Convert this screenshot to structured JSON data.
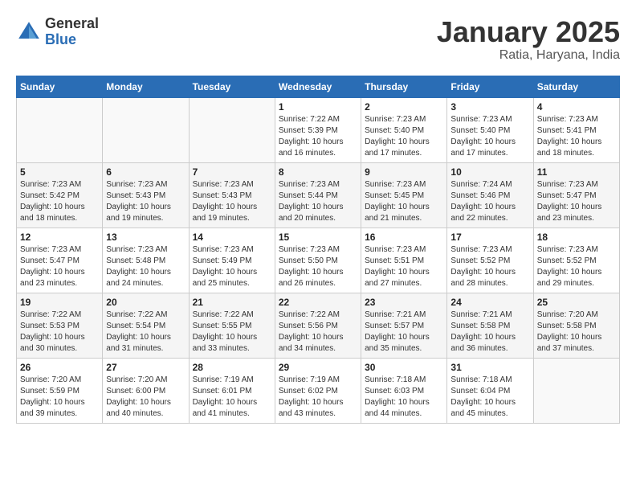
{
  "header": {
    "logo_general": "General",
    "logo_blue": "Blue",
    "month_title": "January 2025",
    "location": "Ratia, Haryana, India"
  },
  "days_of_week": [
    "Sunday",
    "Monday",
    "Tuesday",
    "Wednesday",
    "Thursday",
    "Friday",
    "Saturday"
  ],
  "weeks": [
    [
      {
        "day": "",
        "info": ""
      },
      {
        "day": "",
        "info": ""
      },
      {
        "day": "",
        "info": ""
      },
      {
        "day": "1",
        "info": "Sunrise: 7:22 AM\nSunset: 5:39 PM\nDaylight: 10 hours\nand 16 minutes."
      },
      {
        "day": "2",
        "info": "Sunrise: 7:23 AM\nSunset: 5:40 PM\nDaylight: 10 hours\nand 17 minutes."
      },
      {
        "day": "3",
        "info": "Sunrise: 7:23 AM\nSunset: 5:40 PM\nDaylight: 10 hours\nand 17 minutes."
      },
      {
        "day": "4",
        "info": "Sunrise: 7:23 AM\nSunset: 5:41 PM\nDaylight: 10 hours\nand 18 minutes."
      }
    ],
    [
      {
        "day": "5",
        "info": "Sunrise: 7:23 AM\nSunset: 5:42 PM\nDaylight: 10 hours\nand 18 minutes."
      },
      {
        "day": "6",
        "info": "Sunrise: 7:23 AM\nSunset: 5:43 PM\nDaylight: 10 hours\nand 19 minutes."
      },
      {
        "day": "7",
        "info": "Sunrise: 7:23 AM\nSunset: 5:43 PM\nDaylight: 10 hours\nand 19 minutes."
      },
      {
        "day": "8",
        "info": "Sunrise: 7:23 AM\nSunset: 5:44 PM\nDaylight: 10 hours\nand 20 minutes."
      },
      {
        "day": "9",
        "info": "Sunrise: 7:23 AM\nSunset: 5:45 PM\nDaylight: 10 hours\nand 21 minutes."
      },
      {
        "day": "10",
        "info": "Sunrise: 7:24 AM\nSunset: 5:46 PM\nDaylight: 10 hours\nand 22 minutes."
      },
      {
        "day": "11",
        "info": "Sunrise: 7:23 AM\nSunset: 5:47 PM\nDaylight: 10 hours\nand 23 minutes."
      }
    ],
    [
      {
        "day": "12",
        "info": "Sunrise: 7:23 AM\nSunset: 5:47 PM\nDaylight: 10 hours\nand 23 minutes."
      },
      {
        "day": "13",
        "info": "Sunrise: 7:23 AM\nSunset: 5:48 PM\nDaylight: 10 hours\nand 24 minutes."
      },
      {
        "day": "14",
        "info": "Sunrise: 7:23 AM\nSunset: 5:49 PM\nDaylight: 10 hours\nand 25 minutes."
      },
      {
        "day": "15",
        "info": "Sunrise: 7:23 AM\nSunset: 5:50 PM\nDaylight: 10 hours\nand 26 minutes."
      },
      {
        "day": "16",
        "info": "Sunrise: 7:23 AM\nSunset: 5:51 PM\nDaylight: 10 hours\nand 27 minutes."
      },
      {
        "day": "17",
        "info": "Sunrise: 7:23 AM\nSunset: 5:52 PM\nDaylight: 10 hours\nand 28 minutes."
      },
      {
        "day": "18",
        "info": "Sunrise: 7:23 AM\nSunset: 5:52 PM\nDaylight: 10 hours\nand 29 minutes."
      }
    ],
    [
      {
        "day": "19",
        "info": "Sunrise: 7:22 AM\nSunset: 5:53 PM\nDaylight: 10 hours\nand 30 minutes."
      },
      {
        "day": "20",
        "info": "Sunrise: 7:22 AM\nSunset: 5:54 PM\nDaylight: 10 hours\nand 31 minutes."
      },
      {
        "day": "21",
        "info": "Sunrise: 7:22 AM\nSunset: 5:55 PM\nDaylight: 10 hours\nand 33 minutes."
      },
      {
        "day": "22",
        "info": "Sunrise: 7:22 AM\nSunset: 5:56 PM\nDaylight: 10 hours\nand 34 minutes."
      },
      {
        "day": "23",
        "info": "Sunrise: 7:21 AM\nSunset: 5:57 PM\nDaylight: 10 hours\nand 35 minutes."
      },
      {
        "day": "24",
        "info": "Sunrise: 7:21 AM\nSunset: 5:58 PM\nDaylight: 10 hours\nand 36 minutes."
      },
      {
        "day": "25",
        "info": "Sunrise: 7:20 AM\nSunset: 5:58 PM\nDaylight: 10 hours\nand 37 minutes."
      }
    ],
    [
      {
        "day": "26",
        "info": "Sunrise: 7:20 AM\nSunset: 5:59 PM\nDaylight: 10 hours\nand 39 minutes."
      },
      {
        "day": "27",
        "info": "Sunrise: 7:20 AM\nSunset: 6:00 PM\nDaylight: 10 hours\nand 40 minutes."
      },
      {
        "day": "28",
        "info": "Sunrise: 7:19 AM\nSunset: 6:01 PM\nDaylight: 10 hours\nand 41 minutes."
      },
      {
        "day": "29",
        "info": "Sunrise: 7:19 AM\nSunset: 6:02 PM\nDaylight: 10 hours\nand 43 minutes."
      },
      {
        "day": "30",
        "info": "Sunrise: 7:18 AM\nSunset: 6:03 PM\nDaylight: 10 hours\nand 44 minutes."
      },
      {
        "day": "31",
        "info": "Sunrise: 7:18 AM\nSunset: 6:04 PM\nDaylight: 10 hours\nand 45 minutes."
      },
      {
        "day": "",
        "info": ""
      }
    ]
  ]
}
